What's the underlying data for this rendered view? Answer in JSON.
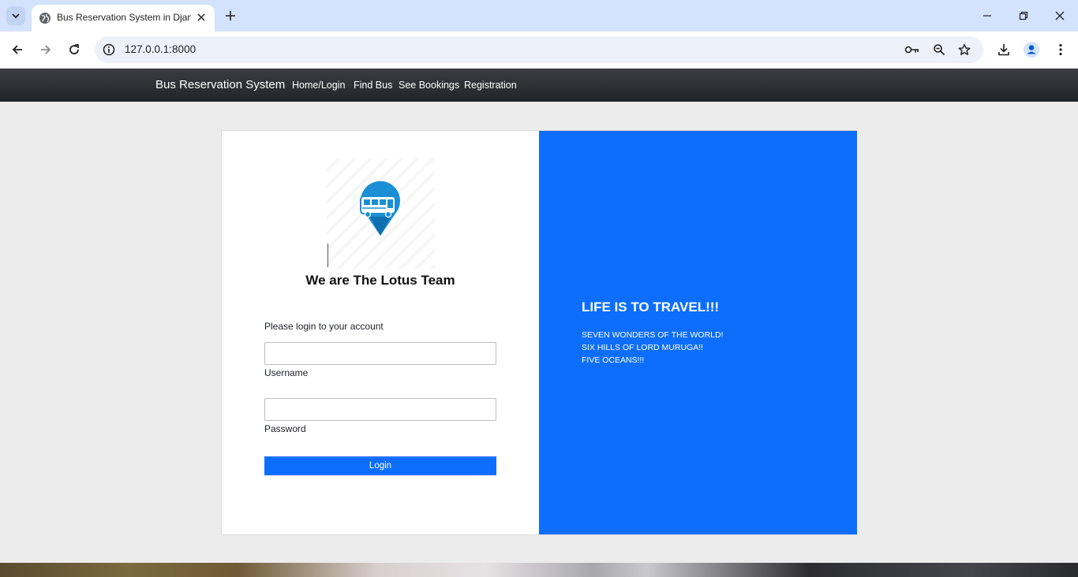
{
  "browser": {
    "tab_title": "Bus Reservation System in Djan",
    "url": "127.0.0.1:8000"
  },
  "navbar": {
    "brand": "Bus Reservation System",
    "links": [
      "Home/Login",
      "Find Bus",
      "See Bookings",
      "Registration"
    ]
  },
  "login": {
    "team_title": "We are The Lotus Team",
    "prompt": "Please login to your account",
    "username_label": "Username",
    "password_label": "Password",
    "username_value": "",
    "password_value": "",
    "login_button": "Login"
  },
  "promo": {
    "title": "LIFE IS TO TRAVEL!!!",
    "lines": [
      "SEVEN WONDERS OF THE WORLD!",
      "SIX HILLS OF LORD MURUGA!!",
      "FIVE OCEANS!!!"
    ]
  },
  "colors": {
    "primary": "#0d6efd",
    "navbar": "#212529",
    "page_bg": "#ececec",
    "logo_blue": "#1a8fd6"
  }
}
